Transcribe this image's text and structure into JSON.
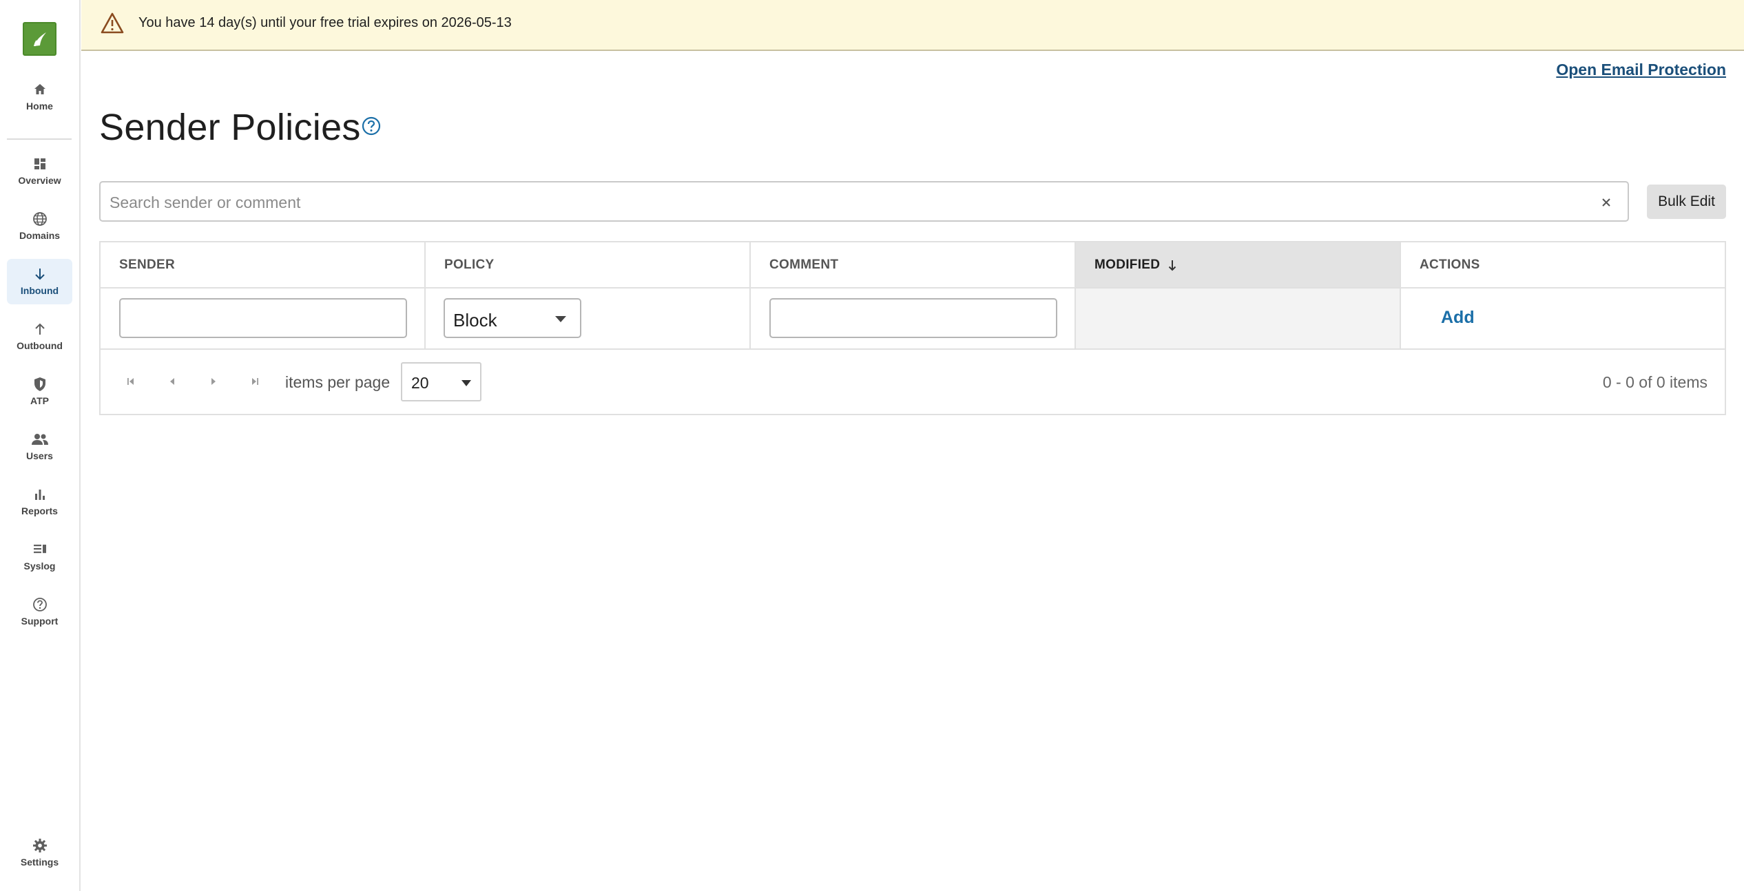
{
  "colors": {
    "accent": "#1b4f7a",
    "banner_bg": "#fdf8dc",
    "logo_green": "#5b9a38",
    "link_blue": "#1b6fa8"
  },
  "sidebar": {
    "items": [
      {
        "label": "Home",
        "icon": "home-icon"
      },
      {
        "label": "Overview",
        "icon": "dashboard-icon"
      },
      {
        "label": "Domains",
        "icon": "globe-icon"
      },
      {
        "label": "Inbound",
        "icon": "arrow-down-icon",
        "active": true
      },
      {
        "label": "Outbound",
        "icon": "arrow-up-icon"
      },
      {
        "label": "ATP",
        "icon": "shield-icon"
      },
      {
        "label": "Users",
        "icon": "users-icon"
      },
      {
        "label": "Reports",
        "icon": "bar-chart-icon"
      },
      {
        "label": "Syslog",
        "icon": "list-icon"
      },
      {
        "label": "Support",
        "icon": "help-circle-icon"
      },
      {
        "label": "Settings",
        "icon": "gear-icon"
      }
    ]
  },
  "banner": {
    "message": "You have 14 day(s) until your free trial expires on 2026-05-13",
    "icon": "warning-icon"
  },
  "header": {
    "email_link": "Open Email Protection"
  },
  "page": {
    "title": "Sender Policies"
  },
  "search": {
    "placeholder": "Search sender or comment"
  },
  "bulk_edit_label": "Bulk Edit",
  "table": {
    "columns": [
      "SENDER",
      "POLICY",
      "COMMENT",
      "MODIFIED",
      "ACTIONS"
    ],
    "sorted_column": "MODIFIED",
    "sort_direction": "descending",
    "new_row": {
      "sender": "",
      "policy": "Block",
      "comment": "",
      "action": "Add"
    }
  },
  "pagination": {
    "items_per_page_label": "items per page",
    "items_per_page": "20",
    "info": "0 - 0 of 0 items"
  }
}
